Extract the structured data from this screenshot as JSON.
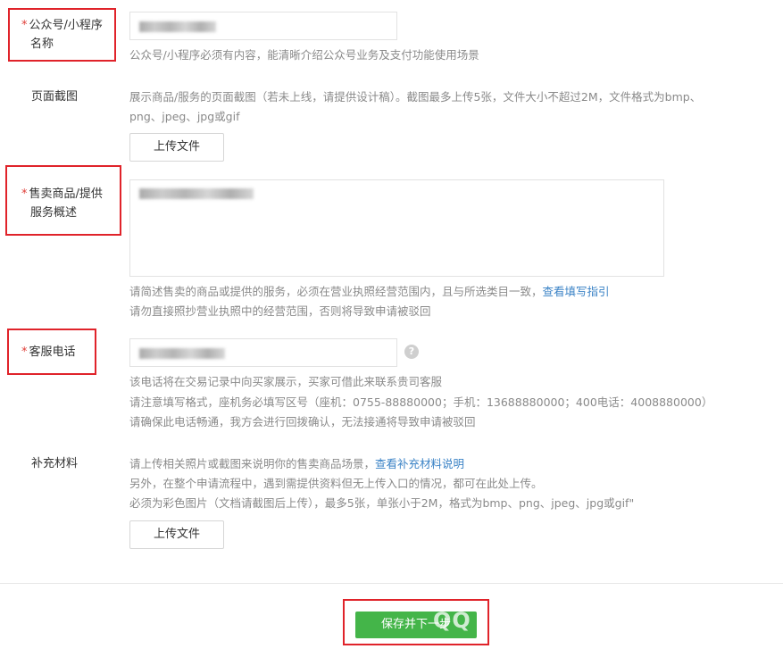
{
  "fields": {
    "official_account": {
      "label": "公众号/小程序名称",
      "label_line1": "公众号/小程序",
      "label_line2": "名称",
      "required_mark": "*",
      "value": "",
      "hint": "公众号/小程序必须有内容，能清晰介绍公众号业务及支付功能使用场景"
    },
    "page_screenshot": {
      "label": "页面截图",
      "hint_line1": "展示商品/服务的页面截图（若未上线，请提供设计稿）。截图最多上传5张，文件大小不超过2M，文件格式为bmp、",
      "hint_line2": "png、jpeg、jpg或gif",
      "upload_button": "上传文件"
    },
    "goods_description": {
      "label_line1": "售卖商品/提供",
      "label_line2": "服务概述",
      "required_mark": "*",
      "value": "",
      "hint_line1": "请简述售卖的商品或提供的服务，必须在营业执照经营范围内，且与所选类目一致，",
      "hint_link": "查看填写指引",
      "hint_line2": "请勿直接照抄营业执照中的经营范围，否则将导致申请被驳回"
    },
    "service_phone": {
      "label": "客服电话",
      "required_mark": "*",
      "value": "",
      "help_icon": "question-icon",
      "hint_line1": "该电话将在交易记录中向买家展示，买家可借此来联系贵司客服",
      "hint_line2": "请注意填写格式，座机务必填写区号（座机：0755-88880000；手机：13688880000；400电话：4008880000）",
      "hint_line3": "请确保此电话畅通，我方会进行回拨确认，无法接通将导致申请被驳回"
    },
    "supplementary": {
      "label": "补充材料",
      "hint_line1": "请上传相关照片或截图来说明你的售卖商品场景，",
      "hint_link": "查看补充材料说明",
      "hint_line2": "另外，在整个申请流程中，遇到需提供资料但无上传入口的情况，都可在此处上传。",
      "hint_line3": "必须为彩色图片（文档请截图后上传），最多5张，单张小于2M，格式为bmp、png、jpeg、jpg或gif\"",
      "upload_button": "上传文件"
    }
  },
  "footer": {
    "save_next_button": "保存并下一步",
    "watermark": "QQ"
  },
  "colors": {
    "primary_green": "#44b549",
    "link_blue": "#3b83c6",
    "required_red": "#e0403a",
    "highlight_box_red": "#e0232a"
  }
}
